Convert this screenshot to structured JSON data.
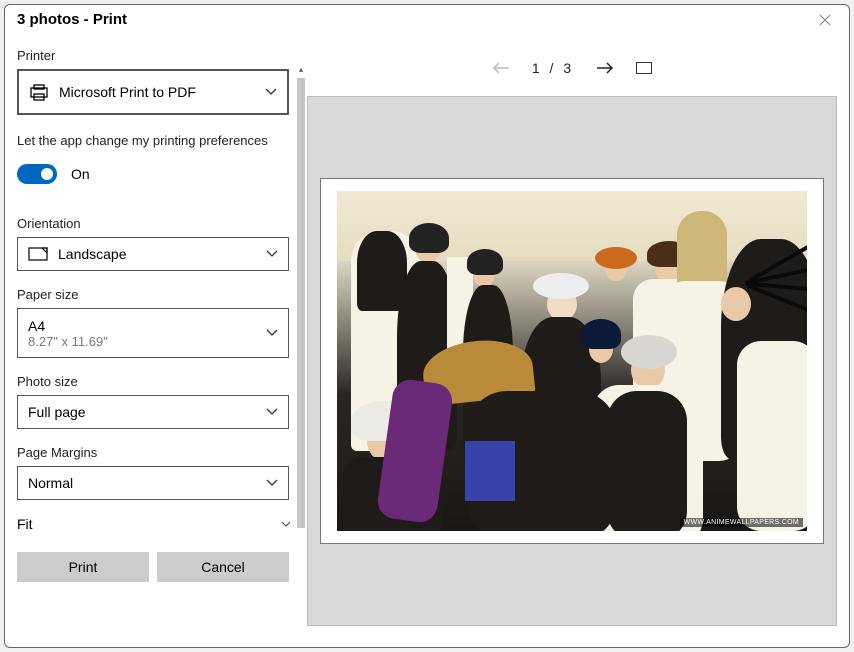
{
  "window": {
    "title": "3 photos - Print"
  },
  "printer": {
    "label": "Printer",
    "selected": "Microsoft Print to PDF"
  },
  "preferences": {
    "prompt": "Let the app change my printing preferences",
    "toggle_on": true,
    "toggle_label": "On"
  },
  "orientation": {
    "label": "Orientation",
    "selected": "Landscape"
  },
  "paper": {
    "label": "Paper size",
    "selected": "A4",
    "dimensions": "8.27\" x 11.69\""
  },
  "photosize": {
    "label": "Photo size",
    "selected": "Full page"
  },
  "margins": {
    "label": "Page Margins",
    "selected": "Normal"
  },
  "fit": {
    "label": "Fit"
  },
  "buttons": {
    "print": "Print",
    "cancel": "Cancel"
  },
  "pager": {
    "current": "1",
    "sep": "/",
    "total": "3"
  },
  "preview": {
    "watermark": "WWW.ANIMEWALLPAPERS.COM"
  },
  "colors": {
    "accent": "#0067c0"
  }
}
